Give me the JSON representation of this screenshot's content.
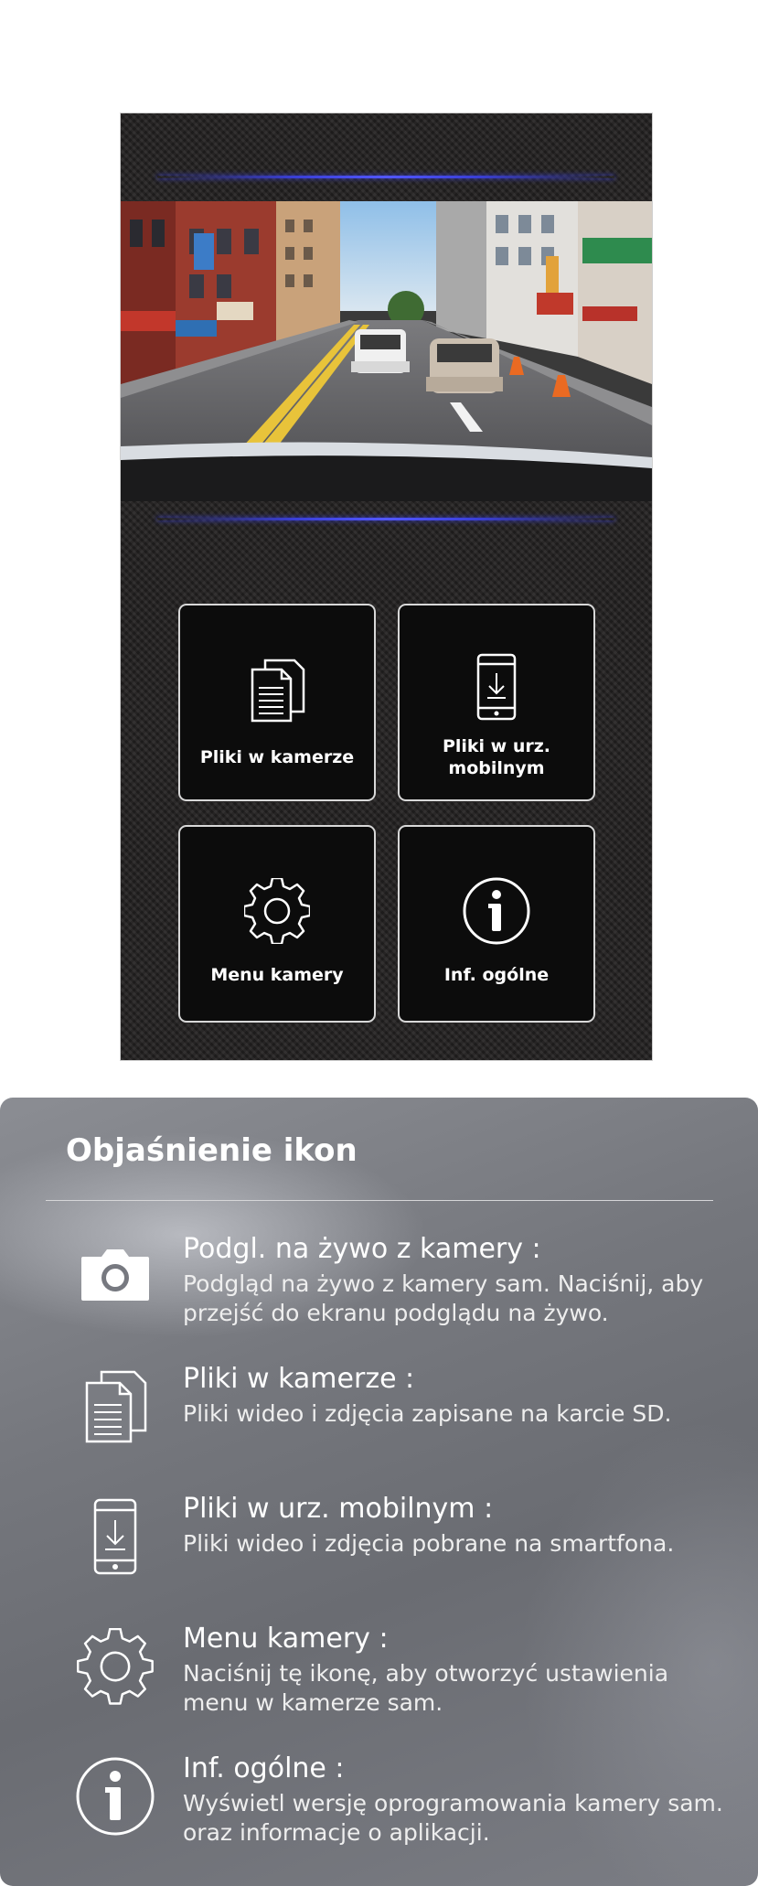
{
  "grid": {
    "camera_files_label": "Pliki w kamerze",
    "mobile_files_label": "Pliki w urz.\nmobilnym",
    "camera_menu_label": "Menu kamery",
    "general_info_label": "Inf. ogólne"
  },
  "legend": {
    "title": "Objaśnienie ikon",
    "items": [
      {
        "icon": "camera-icon",
        "name": "Podgl. na żywo z kamery :",
        "desc": "Podgląd na żywo z kamery sam. Naciśnij, aby przejść do ekranu podglądu na żywo."
      },
      {
        "icon": "documents-icon",
        "name": "Pliki w kamerze :",
        "desc": "Pliki wideo i zdjęcia zapisane na karcie SD."
      },
      {
        "icon": "phone-download-icon",
        "name": "Pliki w urz. mobilnym :",
        "desc": "Pliki wideo i zdjęcia pobrane na smartfona."
      },
      {
        "icon": "gear-icon",
        "name": "Menu kamery :",
        "desc": "Naciśnij tę ikonę, aby otworzyć ustawienia menu w kamerze sam."
      },
      {
        "icon": "info-icon",
        "name": "Inf. ogólne :",
        "desc": "Wyświetl wersję oprogramowania kamery sam. oraz informacje o aplikacji."
      }
    ]
  },
  "colors": {
    "accent_line": "#3a3fd6",
    "tile_bg": "#0c0c0c",
    "phone_bg": "#232121"
  }
}
